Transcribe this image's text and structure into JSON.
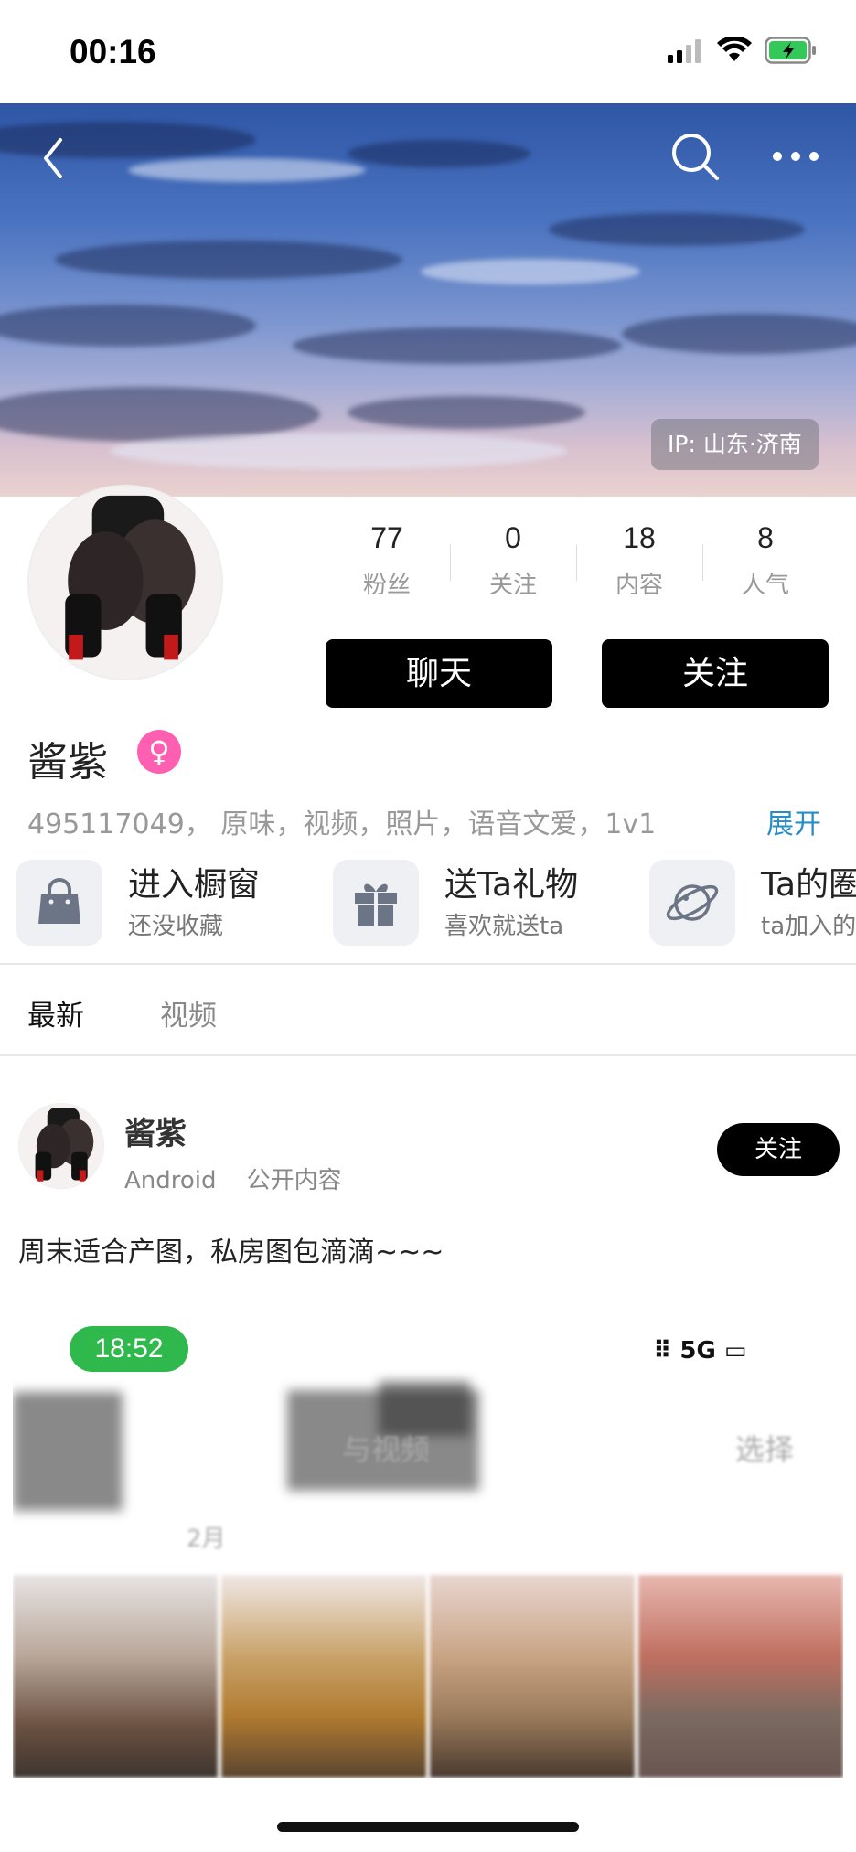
{
  "status_bar": {
    "time": "00:16"
  },
  "cover": {
    "ip_label": "IP: 山东·济南"
  },
  "stats": [
    {
      "value": "77",
      "label": "粉丝"
    },
    {
      "value": "0",
      "label": "关注"
    },
    {
      "value": "18",
      "label": "内容"
    },
    {
      "value": "8",
      "label": "人气"
    }
  ],
  "actions": {
    "chat_label": "聊天",
    "follow_label": "关注"
  },
  "profile": {
    "name": "酱紫",
    "gender_symbol": "♀",
    "bio": "495117049， 原味，视频，照片，语音文爱，1v1",
    "expand_label": "展开"
  },
  "shortcuts": [
    {
      "title": "进入橱窗",
      "subtitle": "还没收藏",
      "icon": "shopping-bag-icon"
    },
    {
      "title": "送Ta礼物",
      "subtitle": "喜欢就送ta",
      "icon": "gift-icon"
    },
    {
      "title": "Ta的圈",
      "subtitle": "ta加入的",
      "icon": "planet-icon"
    }
  ],
  "tabs": {
    "latest": "最新",
    "video": "视频"
  },
  "post": {
    "author": "酱紫",
    "device": "Android",
    "visibility": "公开内容",
    "follow_label": "关注",
    "text": "周末适合产图，私房图包滴滴~~~"
  },
  "embedded_screenshot": {
    "time": "18:52",
    "network": "5G",
    "header_label": "与视频",
    "select_label": "选择",
    "date_label": "2月"
  },
  "colors": {
    "accent_link": "#2a8cc7",
    "gender_badge": "#ff5fb1",
    "button_black": "#000000",
    "status_green": "#2fb84c"
  }
}
